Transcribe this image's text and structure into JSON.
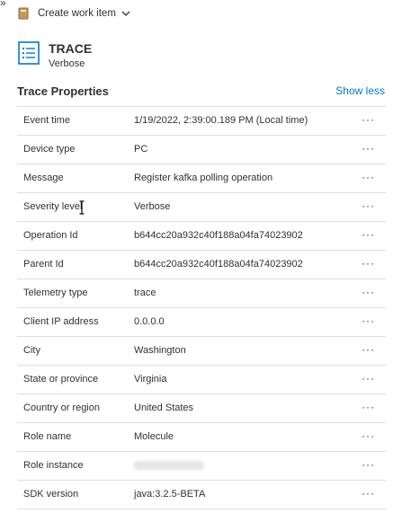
{
  "toolbar": {
    "chevron": "»",
    "create_label": "Create work item",
    "icons": [
      "work-item-icon",
      "chevron-down-icon"
    ]
  },
  "header": {
    "title": "TRACE",
    "subtitle": "Verbose",
    "icon": "list-icon"
  },
  "section": {
    "title": "Trace Properties",
    "toggle_label": "Show less"
  },
  "more_label": "···",
  "rows": [
    {
      "key": "Event time",
      "value": "1/19/2022, 2:39:00.189 PM (Local time)"
    },
    {
      "key": "Device type",
      "value": "PC"
    },
    {
      "key": "Message",
      "value": "Register kafka polling operation"
    },
    {
      "key": "Severity level",
      "value": "Verbose"
    },
    {
      "key": "Operation Id",
      "value": "b644cc20a932c40f188a04fa74023902"
    },
    {
      "key": "Parent Id",
      "value": "b644cc20a932c40f188a04fa74023902"
    },
    {
      "key": "Telemetry type",
      "value": "trace"
    },
    {
      "key": "Client IP address",
      "value": "0.0.0.0"
    },
    {
      "key": "City",
      "value": "Washington"
    },
    {
      "key": "State or province",
      "value": "Virginia"
    },
    {
      "key": "Country or region",
      "value": "United States"
    },
    {
      "key": "Role name",
      "value": "Molecule"
    },
    {
      "key": "Role instance",
      "value": ""
    },
    {
      "key": "SDK version",
      "value": "java:3.2.5-BETA"
    }
  ]
}
